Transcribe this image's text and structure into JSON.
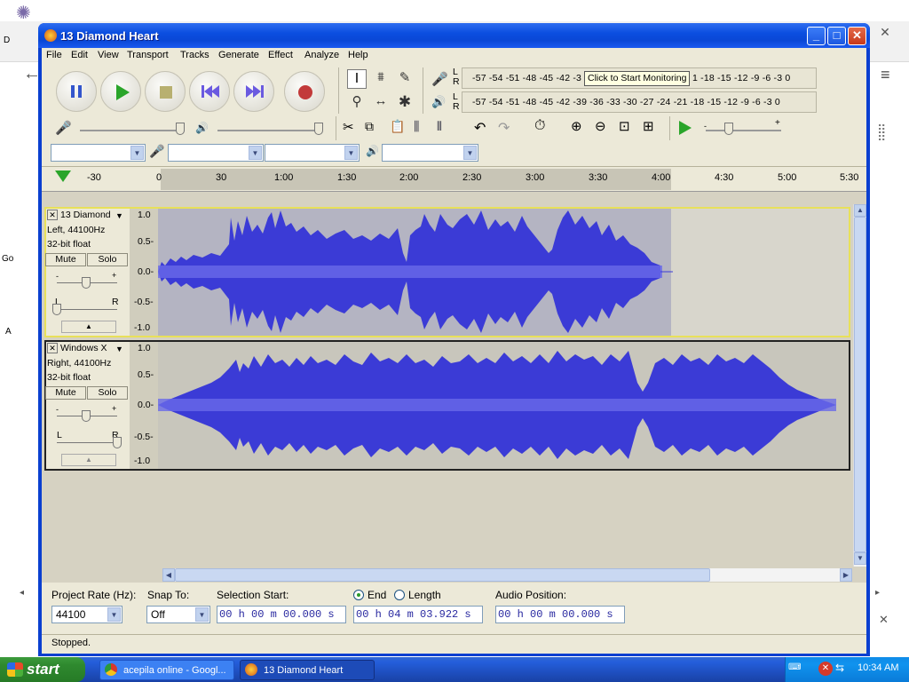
{
  "window": {
    "title": "13 Diamond Heart",
    "minimize": "_",
    "maximize": "□",
    "close": "✕"
  },
  "menu": [
    "File",
    "Edit",
    "View",
    "Transport",
    "Tracks",
    "Generate",
    "Effect",
    "Analyze",
    "Help"
  ],
  "meters": {
    "input_scale": "-57 -54 -51 -48 -45 -42 -3",
    "input_tooltip": "Click to Start Monitoring",
    "input_scale_tail": "1 -18 -15 -12  -9  -6  -3  0",
    "output_scale": "-57 -54 -51 -48 -45 -42 -39 -36 -33 -30 -27 -24 -21 -18 -15 -12  -9  -6  -3  0",
    "lr_top": [
      "L",
      "R"
    ],
    "lr_bottom": [
      "L",
      "R"
    ]
  },
  "ruler": {
    "ticks": [
      "-30",
      "0",
      "30",
      "1:00",
      "1:30",
      "2:00",
      "2:30",
      "3:00",
      "3:30",
      "4:00",
      "4:30",
      "5:00",
      "5:30"
    ]
  },
  "tracks": [
    {
      "name": "13 Diamond",
      "line1": "Left, 44100Hz",
      "line2": "32-bit float",
      "mute": "Mute",
      "solo": "Solo",
      "pan_l": "L",
      "pan_r": "R",
      "scale": [
        "1.0",
        "0.5-",
        "0.0-",
        "-0.5-",
        "-1.0"
      ]
    },
    {
      "name": "Windows X",
      "line1": "Right, 44100Hz",
      "line2": "32-bit float",
      "mute": "Mute",
      "solo": "Solo",
      "pan_l": "L",
      "pan_r": "R",
      "scale": [
        "1.0",
        "0.5-",
        "0.0-",
        "-0.5-",
        "-1.0"
      ]
    }
  ],
  "selection": {
    "project_rate_label": "Project Rate (Hz):",
    "project_rate": "44100",
    "snap_label": "Snap To:",
    "snap_value": "Off",
    "start_label": "Selection Start:",
    "start_value": "00 h 00 m 00.000 s",
    "end_label": "End",
    "length_label": "Length",
    "end_value": "00 h 04 m 03.922 s",
    "position_label": "Audio Position:",
    "position_value": "00 h 00 m 00.000 s"
  },
  "status": "Stopped.",
  "taskbar": {
    "start": "start",
    "task1": "acepila online - Googl...",
    "task2": "13 Diamond Heart",
    "clock": "10:34 AM"
  },
  "background": {
    "left_texts": [
      "D",
      "Go",
      "A"
    ]
  },
  "colors": {
    "wave": "#3b3bd6",
    "titlebar": "#0a47d6",
    "taskbar": "#245edb"
  }
}
